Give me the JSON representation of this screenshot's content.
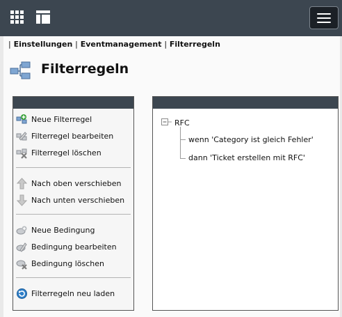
{
  "breadcrumb": {
    "sep": "|",
    "item1": "Einstellungen",
    "item2": "Eventmanagement",
    "item3": "Filterregeln"
  },
  "page": {
    "title": "Filterregeln"
  },
  "actions": {
    "new_rule": "Neue Filterregel",
    "edit_rule": "Filterregel bearbeiten",
    "delete_rule": "Filterregel löschen",
    "move_up": "Nach oben verschieben",
    "move_down": "Nach unten verschieben",
    "new_condition": "Neue Bedingung",
    "edit_condition": "Bedingung bearbeiten",
    "delete_condition": "Bedingung löschen",
    "reload": "Filterregeln neu laden"
  },
  "tree": {
    "root": "RFC",
    "condition": "wenn 'Category ist gleich Fehler'",
    "action": "dann 'Ticket erstellen mit RFC'"
  },
  "colors": {
    "topbar": "#3c4650",
    "panel_header": "#3c4650",
    "background": "#e9e9e9"
  },
  "icons": {
    "apps": "grid-icon",
    "layout": "panel-layout-icon",
    "menu": "hamburger-icon",
    "page": "filter-rules-icon"
  }
}
